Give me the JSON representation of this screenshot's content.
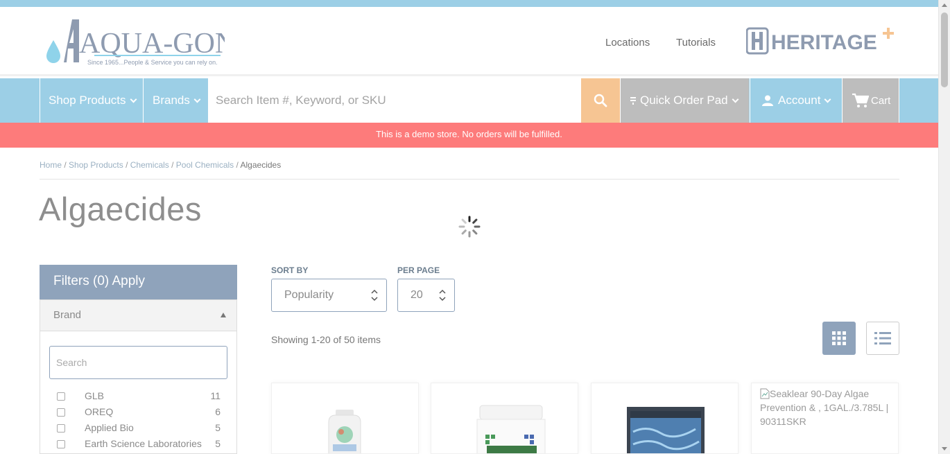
{
  "header": {
    "logo_text": "AQUA-GON",
    "logo_tagline": "Since 1965...People & Service you can rely on.",
    "links": [
      "Locations",
      "Tutorials"
    ],
    "partner_logo_text": "HERITAGE"
  },
  "nav": {
    "shop_products": "Shop Products",
    "brands": "Brands",
    "search_placeholder": "Search Item #, Keyword, or SKU",
    "quick_order_pad": "Quick Order Pad",
    "account": "Account",
    "cart": "Cart"
  },
  "banner": "This is a demo store. No orders will be fulfilled.",
  "breadcrumb": [
    "Home",
    "Shop Products",
    "Chemicals",
    "Pool Chemicals",
    "Algaecides"
  ],
  "page_title": "Algaecides",
  "filters": {
    "title": "Filters (0) Apply",
    "brand_heading": "Brand",
    "search_placeholder": "Search",
    "brands": [
      {
        "name": "GLB",
        "count": "11"
      },
      {
        "name": "OREQ",
        "count": "6"
      },
      {
        "name": "Applied Bio",
        "count": "5"
      },
      {
        "name": "Earth Science Laboratories",
        "count": "5"
      }
    ]
  },
  "sort": {
    "label": "SORT BY",
    "value": "Popularity",
    "per_page_label": "PER PAGE",
    "per_page_value": "20"
  },
  "showing": "Showing 1-20 of 50 items",
  "products": [
    {
      "alt": ""
    },
    {
      "alt": ""
    },
    {
      "alt": ""
    },
    {
      "alt": "Seaklear 90-Day Algae Prevention & , 1GAL./3.785L | 90311SKR"
    }
  ],
  "colors": {
    "nav_blue": "#9ccfe6",
    "demo_red": "#fd7b7b",
    "search_orange": "#f6c593",
    "filter_slate": "#8fa3bb"
  }
}
